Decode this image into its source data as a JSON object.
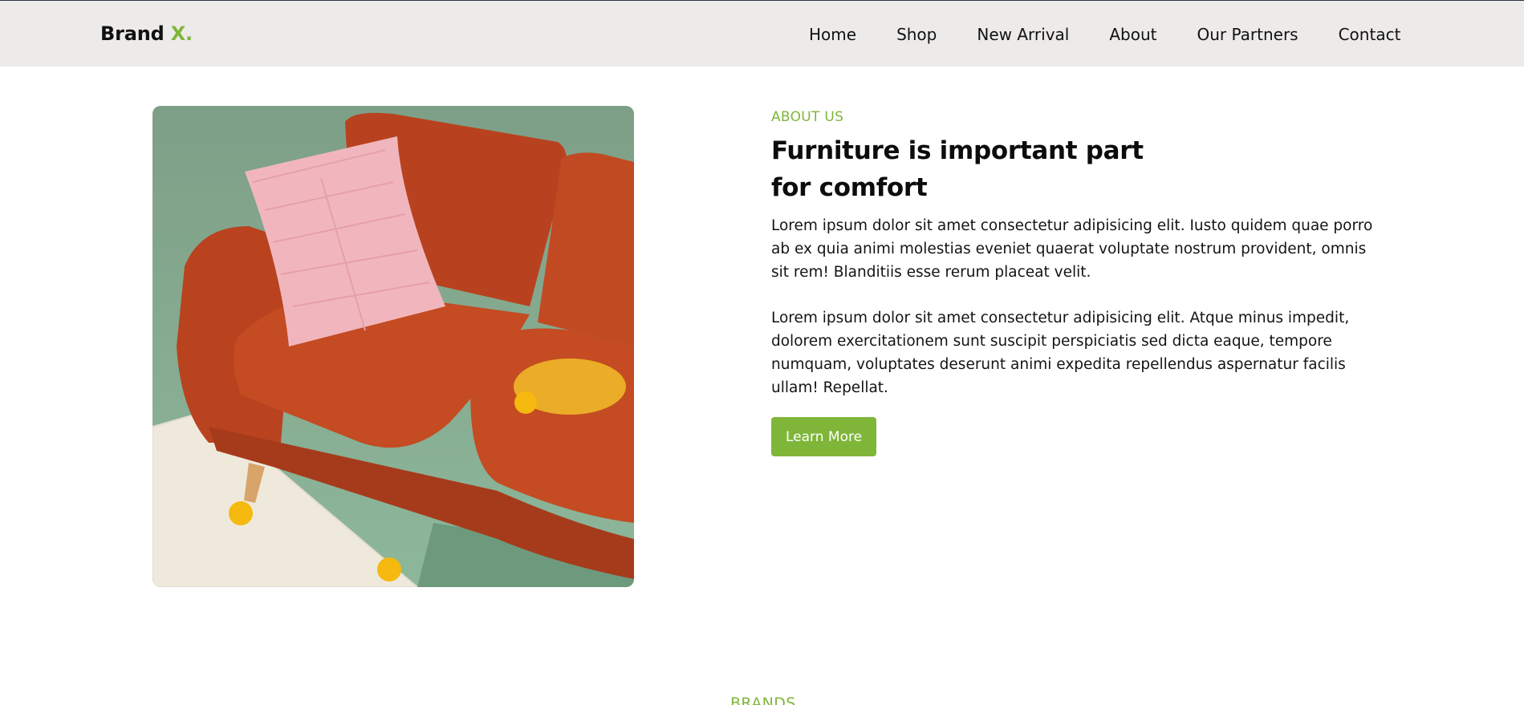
{
  "brand": {
    "name": "Brand",
    "accent": "X."
  },
  "nav": {
    "items": [
      "Home",
      "Shop",
      "New Arrival",
      "About",
      "Our Partners",
      "Contact"
    ]
  },
  "hero_image": {
    "alt": "orange-sofa-photo"
  },
  "about": {
    "eyebrow": "ABOUT US",
    "headline_line1": "Furniture is important part",
    "headline_line2": "for comfort",
    "paragraph1": "Lorem ipsum dolor sit amet consectetur adipisicing elit. Iusto quidem quae porro ab ex quia animi molestias eveniet quaerat voluptate nostrum provident, omnis sit rem! Blanditiis esse rerum placeat velit.",
    "paragraph2": "Lorem ipsum dolor sit amet consectetur adipisicing elit. Atque minus impedit, dolorem exercitationem sunt suscipit perspiciatis sed dicta eaque, tempore numquam, voluptates deserunt animi expedita repellendus aspernatur facilis ullam! Repellat.",
    "cta_label": "Learn More"
  },
  "brands": {
    "heading": "BRANDS"
  },
  "colors": {
    "accent": "#7fb63a",
    "navbar_bg": "#edebea",
    "text": "#111111"
  }
}
